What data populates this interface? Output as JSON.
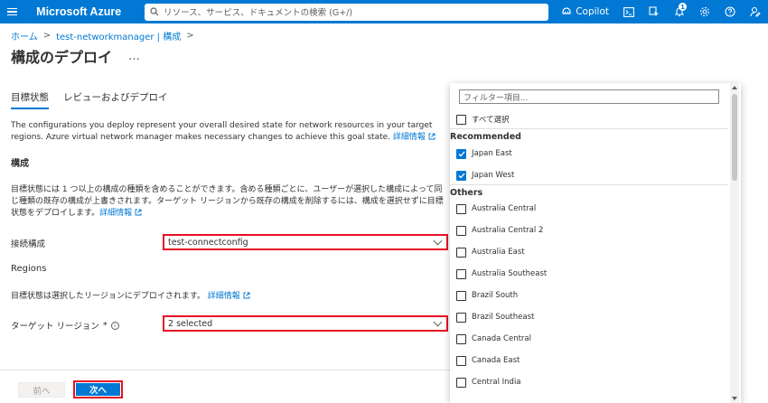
{
  "topbar": {
    "brand": "Microsoft Azure",
    "search_placeholder": "リソース、サービス、ドキュメントの検索 (G+/)",
    "copilot": "Copilot",
    "notification_count": "1"
  },
  "breadcrumb": {
    "home": "ホーム",
    "parent": "test-networkmanager | 構成",
    "sep": ">"
  },
  "page": {
    "title": "構成のデプロイ",
    "more": "…"
  },
  "tabs": [
    "目標状態",
    "レビューおよびデプロイ"
  ],
  "intro": {
    "text": "The configurations you deploy represent your overall desired state for network resources in your target regions. Azure virtual network manager makes necessary changes to achieve this goal state. ",
    "link": "詳細情報"
  },
  "config_section": {
    "title": "構成",
    "text": "目標状態には 1 つ以上の構成の種類を含めることができます。含める種類ごとに、ユーザーが選択した構成によって同じ種類の既存の構成が上書きされます。ターゲット リージョンから既存の構成を削除するには、構成を選択せずに目標状態をデプロイします。",
    "link": "詳細情報",
    "field_label": "接続構成",
    "field_value": "test-connectconfig"
  },
  "regions_section": {
    "title": "Regions",
    "text": "目標状態は選択したリージョンにデプロイされます。",
    "link": "詳細情報",
    "field_label": "ターゲット リージョン",
    "required_mark": "*",
    "field_value": "2 selected"
  },
  "footer": {
    "prev": "前へ",
    "next": "次へ"
  },
  "dropdown": {
    "filter_placeholder": "フィルター項目...",
    "select_all": "すべて選択",
    "recommended_label": "Recommended",
    "recommended": [
      {
        "label": "Japan East",
        "checked": true
      },
      {
        "label": "Japan West",
        "checked": true
      }
    ],
    "others_label": "Others",
    "others": [
      {
        "label": "Australia Central",
        "checked": false
      },
      {
        "label": "Australia Central 2",
        "checked": false
      },
      {
        "label": "Australia East",
        "checked": false
      },
      {
        "label": "Australia Southeast",
        "checked": false
      },
      {
        "label": "Brazil South",
        "checked": false
      },
      {
        "label": "Brazil Southeast",
        "checked": false
      },
      {
        "label": "Canada Central",
        "checked": false
      },
      {
        "label": "Canada East",
        "checked": false
      },
      {
        "label": "Central India",
        "checked": false
      }
    ]
  },
  "colors": {
    "accent": "#0078d4",
    "highlight": "#e81123"
  }
}
